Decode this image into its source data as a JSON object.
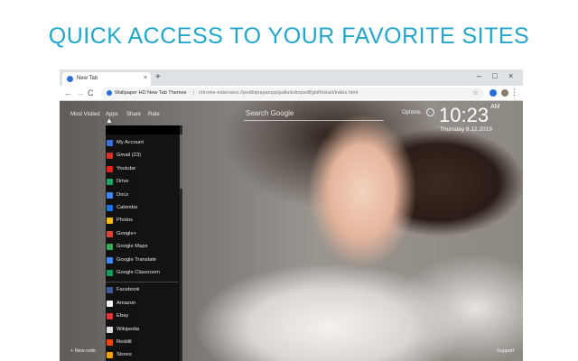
{
  "headline": "QUICK ACCESS TO YOUR FAVORITE SITES",
  "browser": {
    "tab_title": "New Tab",
    "tab_close": "×",
    "new_tab": "+",
    "window_controls": [
      "–",
      "□",
      "×"
    ],
    "nav": [
      "←",
      "→",
      "C"
    ],
    "url_title": "Wallpaper HD New Tab Themes",
    "url_separator": "|",
    "url": "chrome-extension://pedbipnpjampplpalknkdmpedlfgbifh/start/index.html",
    "star": "☆",
    "menu": "⋮"
  },
  "page": {
    "nav": [
      "Most Visited",
      "Apps",
      "Share",
      "Rate"
    ],
    "search_placeholder": "Search Google",
    "options": "Options",
    "time": "10:23",
    "ampm": "AM",
    "date": "Thursday 8.12.2019",
    "new_note": "+ New note",
    "support": "Support"
  },
  "apps_menu": {
    "google": [
      {
        "label": "My Account",
        "icon": "account-icon",
        "color": "#3b6fd6"
      },
      {
        "label": "Gmail (23)",
        "icon": "gmail-icon",
        "color": "#d93025"
      },
      {
        "label": "Youtube",
        "icon": "youtube-icon",
        "color": "#e62117"
      },
      {
        "label": "Drive",
        "icon": "drive-icon",
        "color": "#1fa463"
      },
      {
        "label": "Docs",
        "icon": "docs-icon",
        "color": "#4285f4"
      },
      {
        "label": "Calendar",
        "icon": "calendar-icon",
        "color": "#1a73e8"
      },
      {
        "label": "Photos",
        "icon": "photos-icon",
        "color": "#fbbc04"
      },
      {
        "label": "Google+",
        "icon": "googleplus-icon",
        "color": "#db4437"
      },
      {
        "label": "Google Maps",
        "icon": "maps-icon",
        "color": "#34a853"
      },
      {
        "label": "Google Translate",
        "icon": "translate-icon",
        "color": "#4285f4"
      },
      {
        "label": "Google Classroom",
        "icon": "classroom-icon",
        "color": "#0f9d58"
      }
    ],
    "sites": [
      {
        "label": "Facebook",
        "icon": "facebook-icon",
        "color": "#3b5998"
      },
      {
        "label": "Amazon",
        "icon": "amazon-icon",
        "color": "#f2f2f2"
      },
      {
        "label": "Ebay",
        "icon": "ebay-icon",
        "color": "#e53238"
      },
      {
        "label": "Wikipedia",
        "icon": "wikipedia-icon",
        "color": "#dddddd"
      },
      {
        "label": "Reddit",
        "icon": "reddit-icon",
        "color": "#ff4500"
      },
      {
        "label": "Stores",
        "icon": "stores-icon",
        "color": "#f4a300"
      }
    ]
  },
  "colors": {
    "headline": "#22a6c9",
    "tab_strip": "#dee1e6",
    "menu_bg": "#0c0c0c"
  }
}
